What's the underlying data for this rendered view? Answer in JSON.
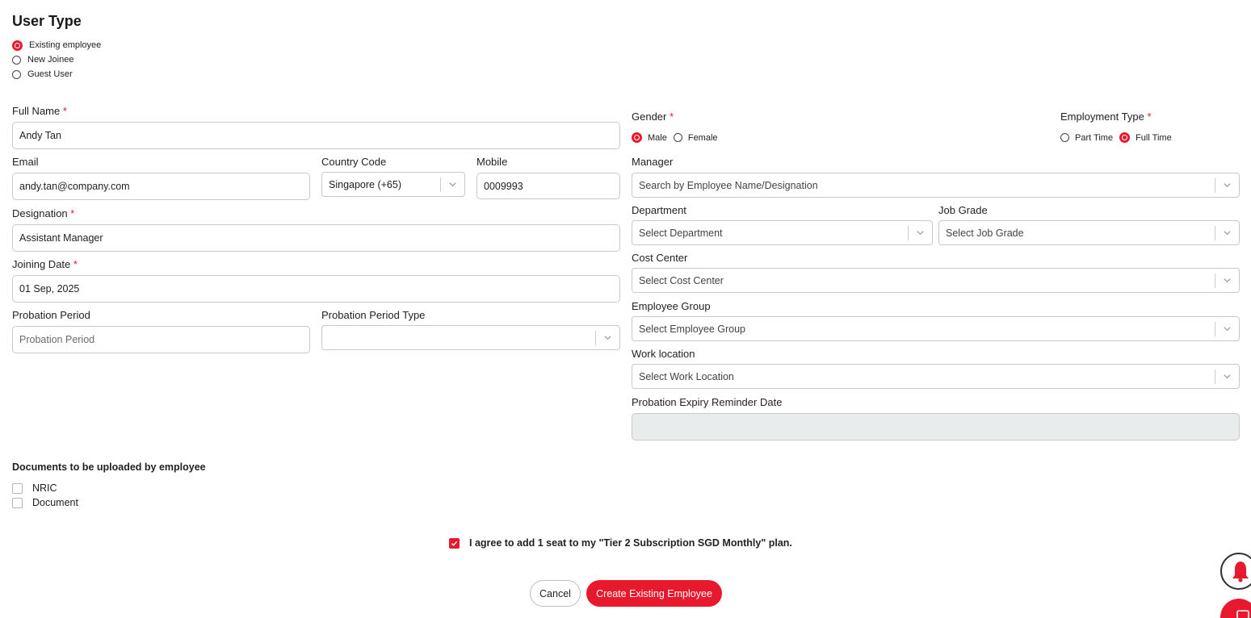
{
  "user_type": {
    "title": "User Type",
    "options": [
      "Existing employee",
      "New Joinee",
      "Guest User"
    ],
    "selected": "Existing employee"
  },
  "form": {
    "full_name": {
      "label": "Full Name",
      "required": "*",
      "value": "Andy Tan"
    },
    "email": {
      "label": "Email",
      "value": "andy.tan@company.com"
    },
    "country_code": {
      "label": "Country Code",
      "value": "Singapore (+65)"
    },
    "mobile": {
      "label": "Mobile",
      "value": "0009993"
    },
    "designation": {
      "label": "Designation",
      "required": "*",
      "value": "Assistant Manager"
    },
    "joining_date": {
      "label": "Joining Date",
      "required": "*",
      "value": "01 Sep, 2025"
    },
    "probation_period": {
      "label": "Probation Period",
      "placeholder": "Probation Period"
    },
    "probation_period_type": {
      "label": "Probation Period Type",
      "value": ""
    },
    "gender": {
      "label": "Gender",
      "required": "*",
      "options": [
        "Male",
        "Female"
      ],
      "selected": "Male"
    },
    "employment_type": {
      "label": "Employment Type",
      "required": "*",
      "options": [
        "Part Time",
        "Full Time"
      ],
      "selected": "Full Time"
    },
    "manager": {
      "label": "Manager",
      "placeholder": "Search by Employee Name/Designation"
    },
    "department": {
      "label": "Department",
      "placeholder": "Select Department"
    },
    "job_grade": {
      "label": "Job Grade",
      "placeholder": "Select Job Grade"
    },
    "cost_center": {
      "label": "Cost Center",
      "placeholder": "Select Cost Center"
    },
    "employee_group": {
      "label": "Employee Group",
      "placeholder": "Select Employee Group"
    },
    "work_location": {
      "label": "Work location",
      "placeholder": "Select Work Location"
    },
    "probation_expiry": {
      "label": "Probation Expiry Reminder Date",
      "value": ""
    }
  },
  "documents": {
    "title": "Documents to be uploaded by employee",
    "items": [
      "NRIC",
      "Document"
    ]
  },
  "agreement": {
    "text": "I agree to add 1 seat to my \"Tier 2 Subscription SGD Monthly\" plan.",
    "checked": true
  },
  "actions": {
    "cancel": "Cancel",
    "create": "Create Existing Employee"
  },
  "colors": {
    "accent": "#e8192c",
    "border": "#c9c9c9",
    "disabled_bg": "#e9ecec"
  },
  "icons": {
    "select_arrow": "chevron-down-icon",
    "notification": "bell-icon",
    "chat": "chat-icon"
  }
}
